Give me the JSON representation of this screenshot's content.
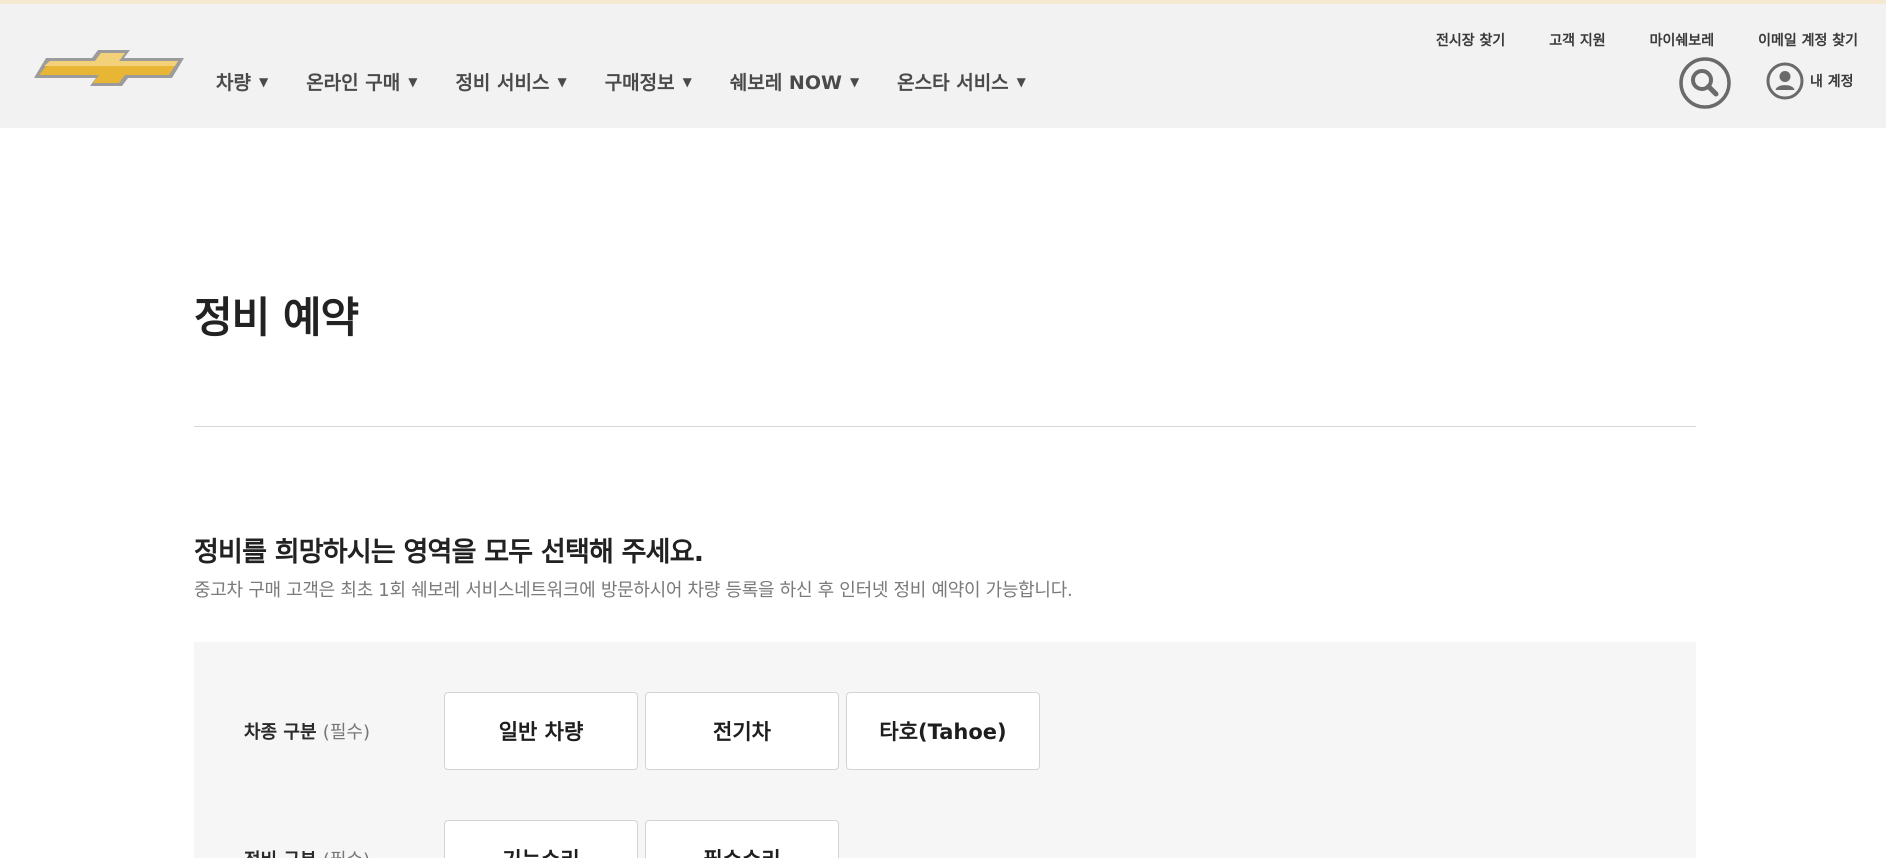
{
  "brand": {
    "logo_icon": "chevrolet-bowtie-icon",
    "accent_color": "#e8b535"
  },
  "header": {
    "main_nav": [
      {
        "label": "차량"
      },
      {
        "label": "온라인 구매"
      },
      {
        "label": "정비 서비스"
      },
      {
        "label": "구매정보"
      },
      {
        "label": "쉐보레 NOW"
      },
      {
        "label": "온스타 서비스"
      }
    ],
    "util_nav": [
      {
        "label": "전시장 찾기"
      },
      {
        "label": "고객 지원"
      },
      {
        "label": "마이쉐보레"
      },
      {
        "label": "이메일 계정 찾기"
      }
    ],
    "search_icon": "search-icon",
    "account": {
      "icon": "user-account-icon",
      "label": "내 계정"
    }
  },
  "page": {
    "title": "정비 예약",
    "section_title": "정비를 희망하시는 영역을 모두 선택해 주세요.",
    "section_desc": "중고차 구매 고객은 최초 1회 쉐보레 서비스네트워크에 방문하시어 차량 등록을 하신 후 인터넷 정비 예약이 가능합니다."
  },
  "form": {
    "rows": [
      {
        "label": "차종 구분",
        "required": "(필수)",
        "options": [
          "일반 차량",
          "전기차",
          "타호(Tahoe)"
        ]
      },
      {
        "label": "정비 구분",
        "required": "(필수)",
        "options": [
          "기능수리",
          "필수수리"
        ]
      }
    ]
  }
}
